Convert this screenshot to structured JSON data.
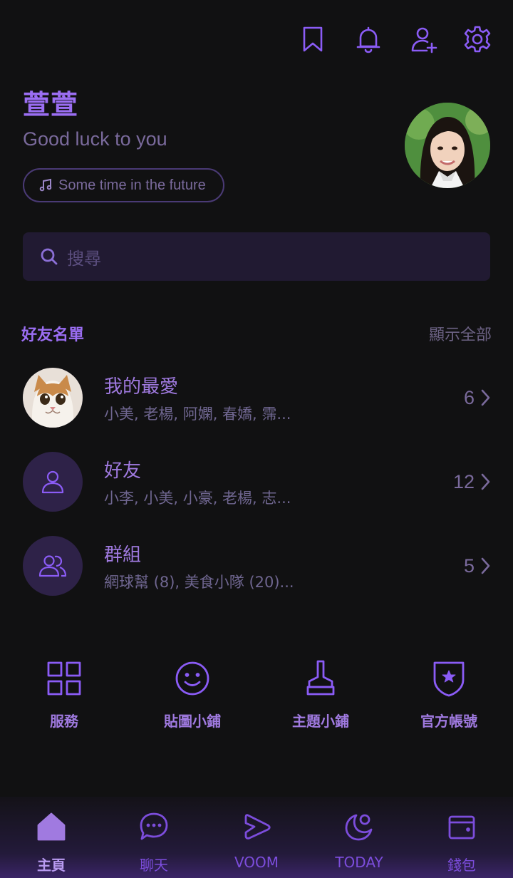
{
  "header": {
    "icons": [
      "bookmark-icon",
      "bell-icon",
      "add-friend-icon",
      "gear-icon"
    ]
  },
  "profile": {
    "name": "萱萱",
    "status": "Good luck to you",
    "music": "Some time in the future"
  },
  "search": {
    "placeholder": "搜尋"
  },
  "friends": {
    "title": "好友名單",
    "show_all": "顯示全部",
    "rows": [
      {
        "title": "我的最愛",
        "subtitle": "小美, 老楊, 阿嫻, 春嬌, 霈...",
        "count": "6"
      },
      {
        "title": "好友",
        "subtitle": "小李, 小美, 小豪, 老楊, 志...",
        "count": "12"
      },
      {
        "title": "群組",
        "subtitle": "網球幫 (8), 美食小隊 (20)...",
        "count": "5"
      }
    ]
  },
  "shortcuts": [
    {
      "label": "服務",
      "icon": "grid-icon"
    },
    {
      "label": "貼圖小鋪",
      "icon": "smiley-icon"
    },
    {
      "label": "主題小鋪",
      "icon": "brush-icon"
    },
    {
      "label": "官方帳號",
      "icon": "shield-star-icon"
    }
  ],
  "nav": [
    {
      "label": "主頁",
      "icon": "home-icon",
      "active": true
    },
    {
      "label": "聊天",
      "icon": "chat-icon"
    },
    {
      "label": "VOOM",
      "icon": "voom-icon"
    },
    {
      "label": "TODAY",
      "icon": "today-icon"
    },
    {
      "label": "錢包",
      "icon": "wallet-icon"
    }
  ],
  "colors": {
    "accent": "#8b5cf6",
    "background": "#111112"
  }
}
